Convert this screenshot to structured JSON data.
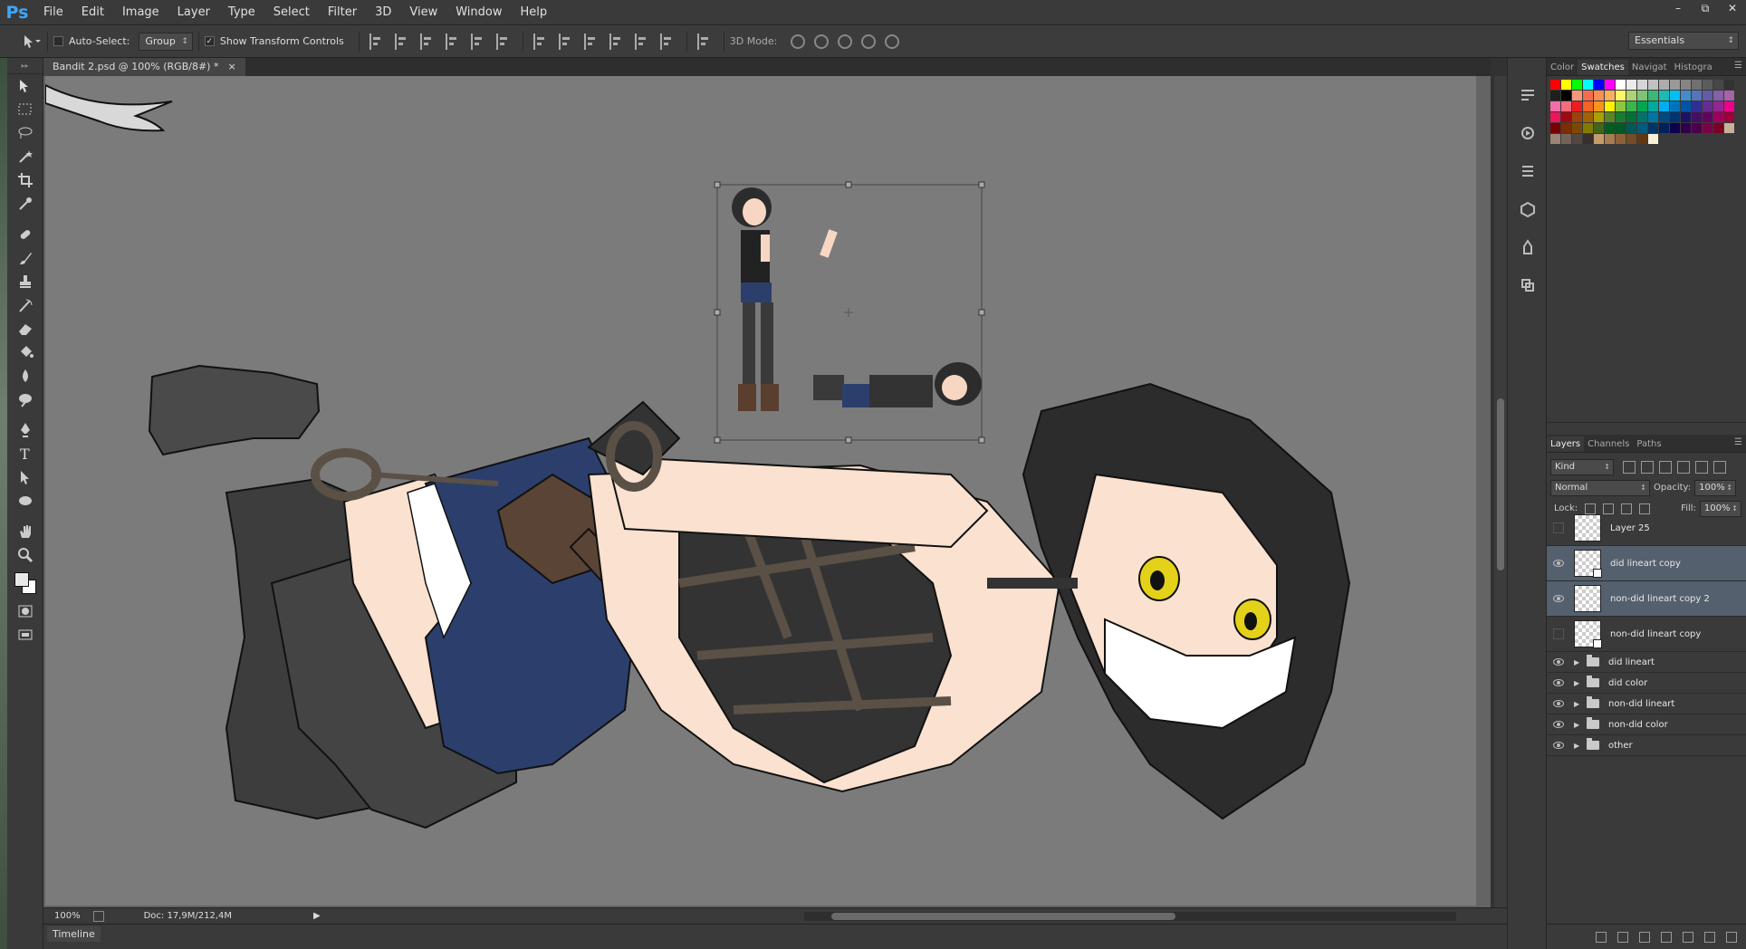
{
  "app": {
    "logo": "Ps",
    "menu": [
      "File",
      "Edit",
      "Image",
      "Layer",
      "Type",
      "Select",
      "Filter",
      "3D",
      "View",
      "Window",
      "Help"
    ],
    "window_controls": [
      "–",
      "⧉",
      "✕"
    ]
  },
  "options": {
    "auto_select_label": "Auto-Select:",
    "auto_select_value": "Group",
    "show_transform_label": "Show Transform Controls",
    "mode3d_label": "3D Mode:",
    "workspace": "Essentials"
  },
  "document": {
    "tab_title": "Bandit 2.psd @ 100% (RGB/8#) *",
    "tab_close": "×",
    "zoom": "100%",
    "doc_info": "Doc: 17,9M/212,4M",
    "timeline_label": "Timeline"
  },
  "swatches_panel": {
    "tabs": [
      "Color",
      "Swatches",
      "Navigat",
      "Histogra"
    ],
    "active_tab": "Swatches",
    "colors": [
      "#ff0000",
      "#ffff00",
      "#00ff00",
      "#00ffff",
      "#0000ff",
      "#ff00ff",
      "#ffffff",
      "#ebebeb",
      "#d6d6d6",
      "#c2c2c2",
      "#adadad",
      "#999999",
      "#858585",
      "#707070",
      "#5c5c5c",
      "#474747",
      "#333333",
      "#1f1f1f",
      "#000000",
      "#f7977a",
      "#f26c4f",
      "#f68e55",
      "#fbaf5d",
      "#fff467",
      "#acd372",
      "#7cc576",
      "#3bb878",
      "#1abbb4",
      "#00bff3",
      "#438ccb",
      "#5574b9",
      "#605ca8",
      "#855fa8",
      "#a763a8",
      "#f06ea9",
      "#f26d7d",
      "#ed1c24",
      "#f26522",
      "#f7941d",
      "#fff200",
      "#8dc63f",
      "#39b54a",
      "#00a651",
      "#00a99d",
      "#00aeef",
      "#0072bc",
      "#0054a6",
      "#2e3192",
      "#662d91",
      "#92278f",
      "#ec008c",
      "#ed145b",
      "#9e0b0f",
      "#a0410d",
      "#a3620a",
      "#aba000",
      "#598527",
      "#197b30",
      "#007236",
      "#00746b",
      "#0076a3",
      "#004a80",
      "#003471",
      "#1b1464",
      "#440e62",
      "#630460",
      "#9e005d",
      "#9e0039",
      "#790000",
      "#7b2e00",
      "#7d4900",
      "#827b00",
      "#406618",
      "#005e20",
      "#005826",
      "#005952",
      "#005b7f",
      "#003663",
      "#002157",
      "#0d004c",
      "#32004b",
      "#4b0049",
      "#7b0046",
      "#7a0026",
      "#c7b299",
      "#998675",
      "#736357",
      "#534741",
      "#362f2d",
      "#c69c6d",
      "#a67c52",
      "#8c6239",
      "#754c24",
      "#603913",
      "#f9f0d8"
    ]
  },
  "layers_panel": {
    "tabs": [
      "Layers",
      "Channels",
      "Paths"
    ],
    "active_tab": "Layers",
    "filter_kind": "Kind",
    "blend_mode": "Normal",
    "opacity_label": "Opacity:",
    "opacity_value": "100%",
    "lock_label": "Lock:",
    "fill_label": "Fill:",
    "fill_value": "100%",
    "layers": [
      {
        "name": "Layer 25",
        "visible": false,
        "selected": false,
        "smart": false
      },
      {
        "name": "did lineart copy",
        "visible": true,
        "selected": true,
        "smart": true
      },
      {
        "name": "non-did lineart copy 2",
        "visible": true,
        "selected": true,
        "smart": false
      },
      {
        "name": "non-did lineart copy",
        "visible": false,
        "selected": false,
        "smart": true
      }
    ],
    "groups": [
      "did lineart",
      "did color",
      "non-did lineart",
      "non-did color",
      "other"
    ]
  },
  "colors": {
    "accent": "#3ea6ff",
    "selected_layer": "#55606e",
    "canvas": "#7b7b7b"
  }
}
